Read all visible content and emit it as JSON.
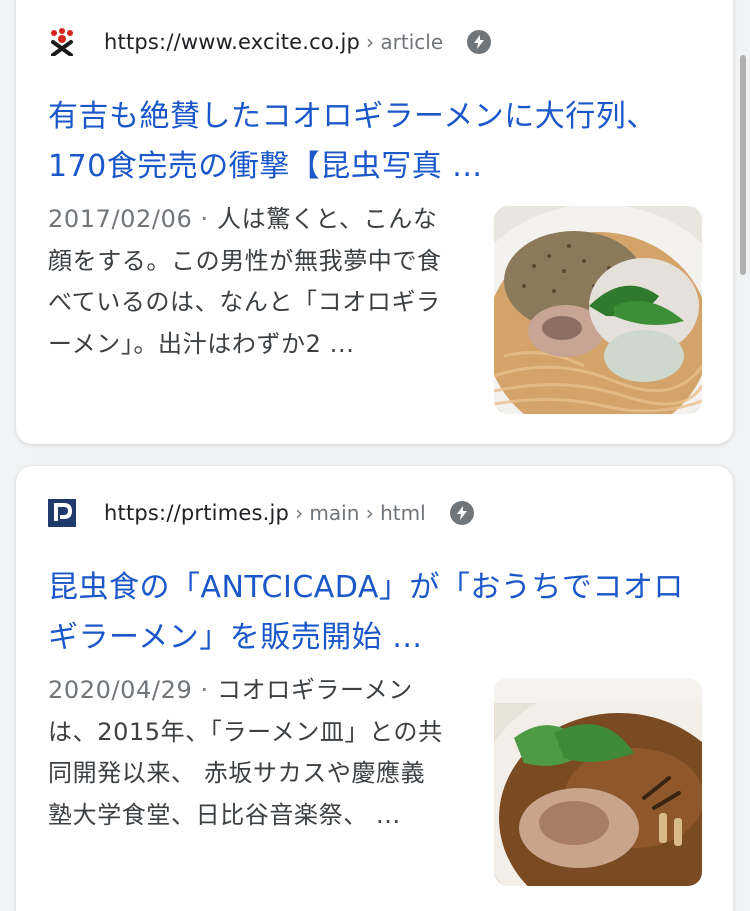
{
  "results": [
    {
      "url": "https://www.excite.co.jp",
      "path": "› article",
      "favicon": "excite-favicon",
      "amp": "amp-lightning-icon",
      "title": "有吉も絶賛したコオロギラーメンに大行列、170食完売の衝撃【昆虫写真 ...",
      "date": "2017/02/06 · ",
      "snippet": "人は驚くと、こんな顔をする。この男性が無我夢中で食べているのは、なんと「コオロギラーメン」。出汁はわずか2  ...",
      "thumbnail": "ramen-bowl-photo"
    },
    {
      "url": "https://prtimes.jp",
      "path": "› main › html",
      "favicon": "prtimes-favicon",
      "amp": "amp-lightning-icon",
      "title": "昆虫食の「ANTCICADA」が「おうちでコオロギラーメン」を販売開始 ...",
      "date": "2020/04/29 · ",
      "snippet": "コオロギラーメンは、2015年、「ラーメン皿」との共同開発以来、 赤坂サカスや慶應義塾大学食堂、日比谷音楽祭、 ...",
      "thumbnail": "ramen-soup-photo"
    }
  ],
  "colors": {
    "title_link": "#1a57c9",
    "url_text": "#202124",
    "meta_text": "#70757a",
    "snippet_text": "#3c4043",
    "page_bg": "#f1f3f4"
  }
}
